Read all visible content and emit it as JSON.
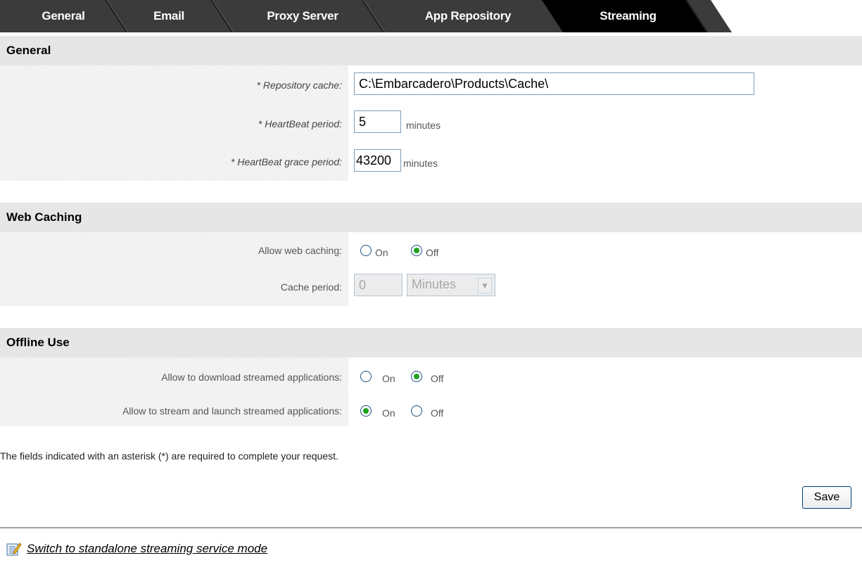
{
  "tabs": [
    {
      "label": "General",
      "active": false
    },
    {
      "label": "Email",
      "active": false
    },
    {
      "label": "Proxy Server",
      "active": false
    },
    {
      "label": "App Repository",
      "active": false
    },
    {
      "label": "Streaming",
      "active": true
    }
  ],
  "sections": {
    "general": {
      "title": "General",
      "repository_cache": {
        "label": "* Repository cache:",
        "value": "C:\\Embarcadero\\Products\\Cache\\"
      },
      "heartbeat_period": {
        "label": "* HeartBeat period:",
        "value": "5",
        "unit": "minutes"
      },
      "heartbeat_grace_period": {
        "label": "* HeartBeat grace period:",
        "value": "43200",
        "unit": "minutes"
      }
    },
    "web_caching": {
      "title": "Web Caching",
      "allow_web_caching": {
        "label": "Allow web caching:",
        "on_label": "On",
        "off_label": "Off",
        "selected": "Off"
      },
      "cache_period": {
        "label": "Cache period:",
        "value": "0",
        "unit_selected": "Minutes"
      }
    },
    "offline_use": {
      "title": "Offline Use",
      "allow_download": {
        "label": "Allow to download streamed applications:",
        "on_label": "On",
        "off_label": "Off",
        "selected": "Off"
      },
      "allow_stream_launch": {
        "label": "Allow to stream and launch streamed applications:",
        "on_label": "On",
        "off_label": "Off",
        "selected": "On"
      }
    }
  },
  "required_note": "The fields indicated with an asterisk (*) are required to complete your request.",
  "save_label": "Save",
  "switch_link": {
    "label": "Switch to standalone streaming service mode",
    "icon": "edit-note-icon"
  },
  "colors": {
    "tab_bar": "#3a3a3a",
    "tab_active": "#000000",
    "section_header": "#e6e6e6",
    "radio_checked": "#21a121"
  }
}
